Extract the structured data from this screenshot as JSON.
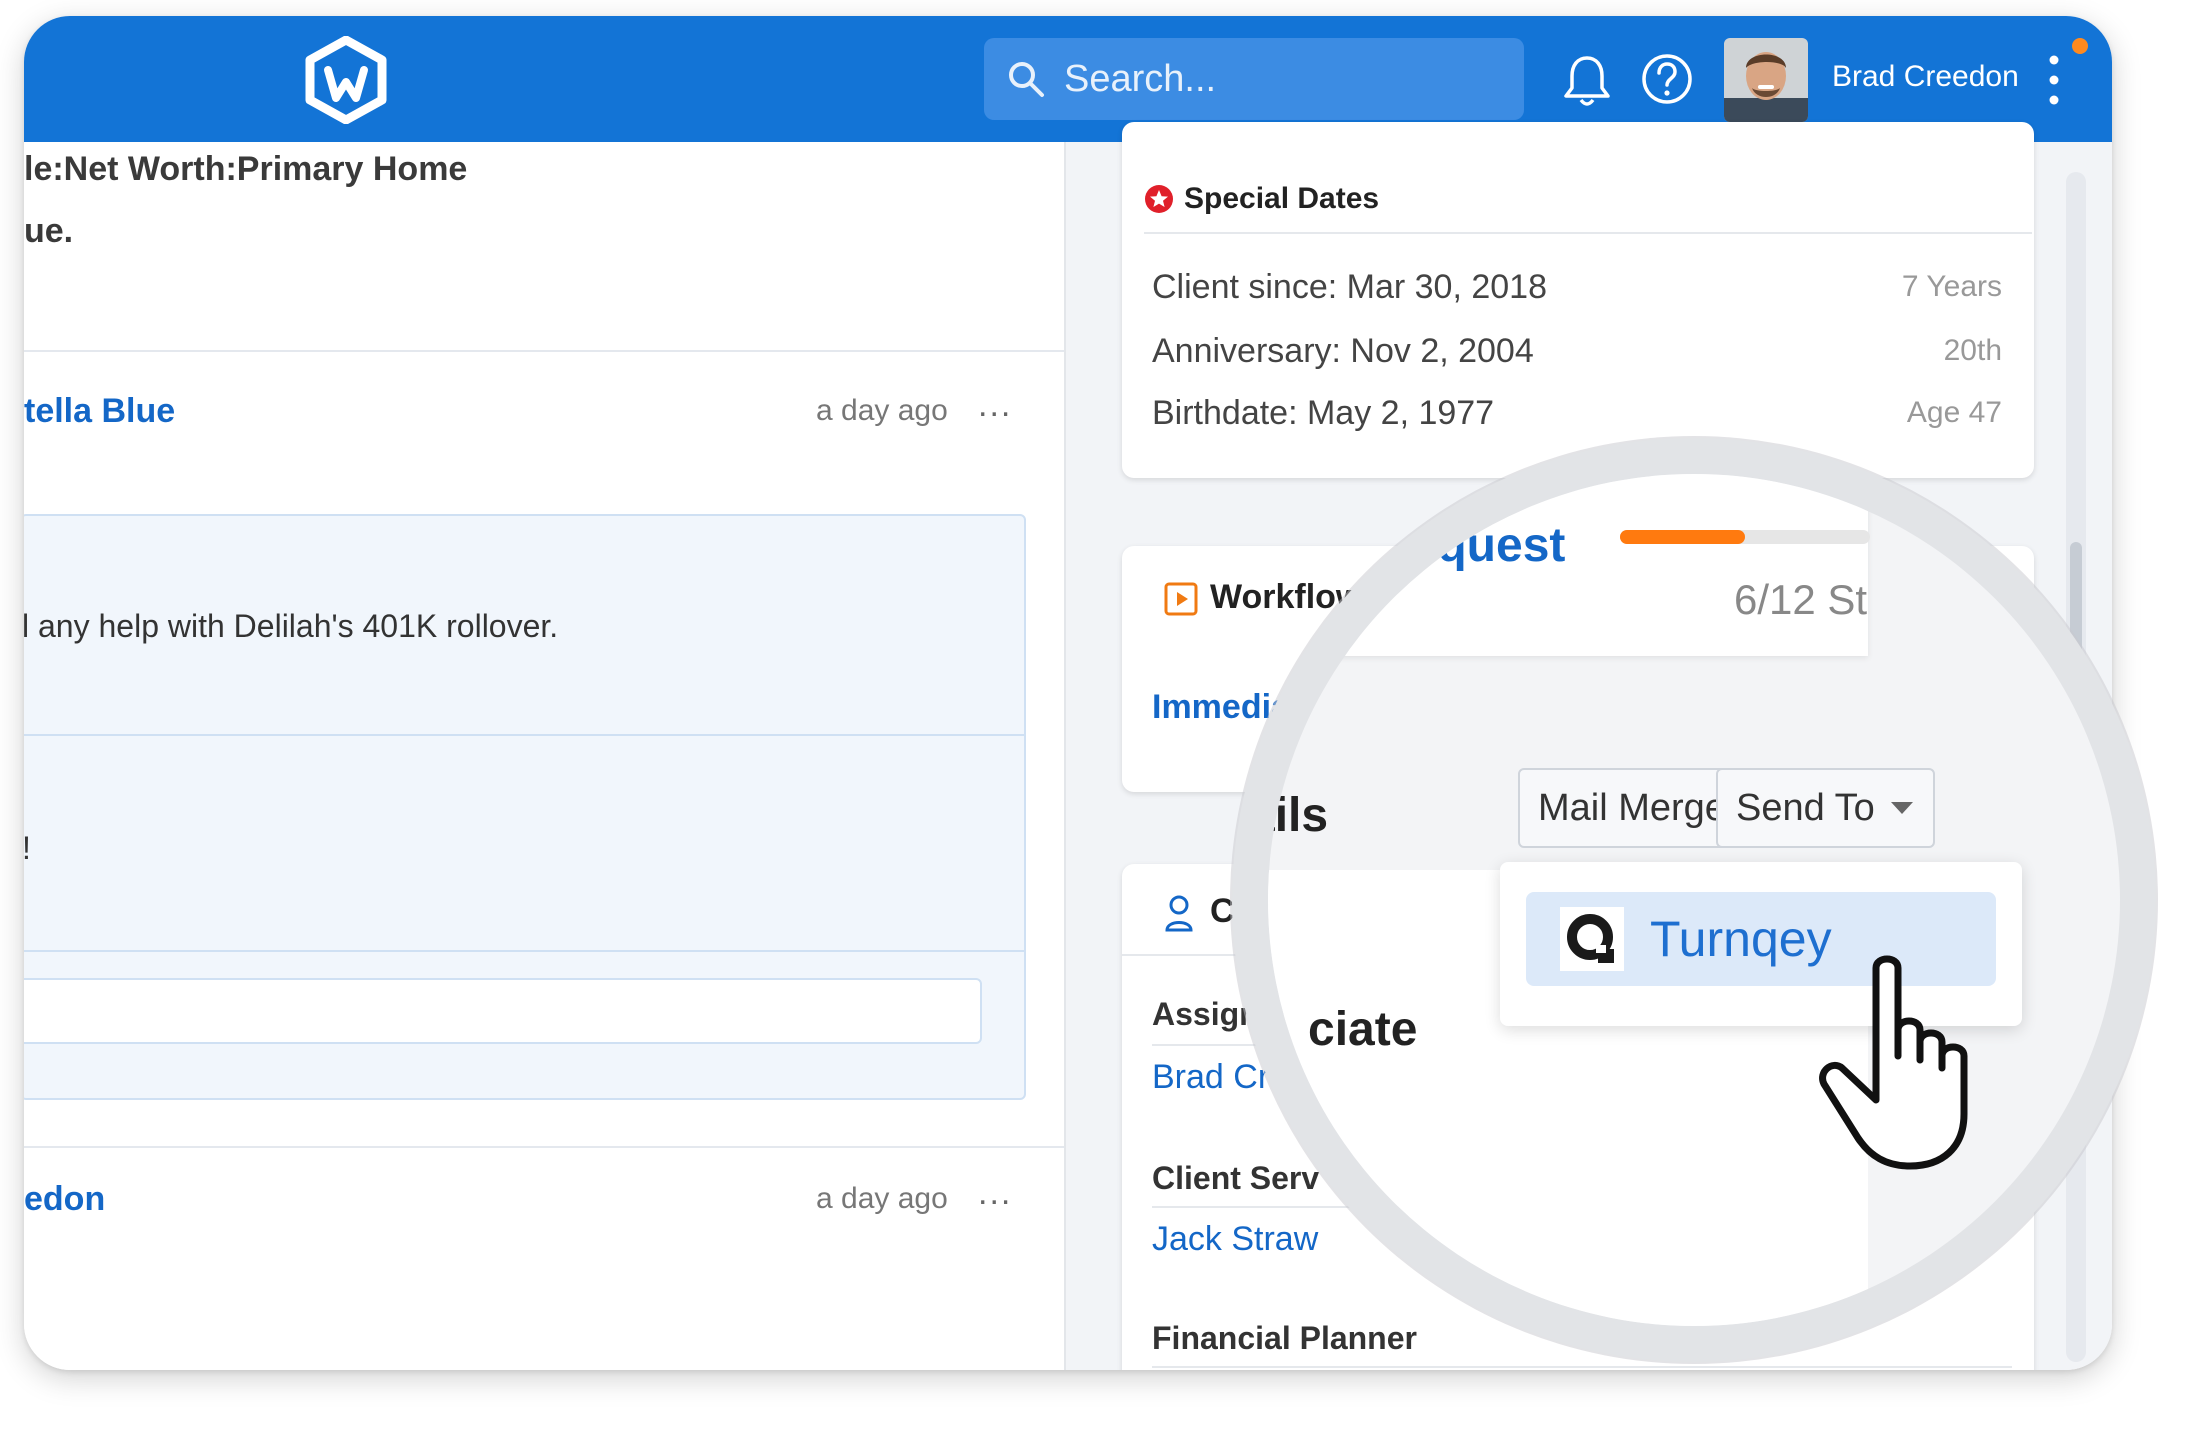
{
  "header": {
    "search_placeholder": "Search...",
    "user_name": "Brad Creedon",
    "icons": [
      "logo-icon",
      "search-icon",
      "bell-icon",
      "help-icon",
      "avatar",
      "kebab-menu-icon"
    ],
    "brand_color": "#1374d6",
    "notification_color": "#ff8a1f"
  },
  "feed": {
    "path_line1": "le:Net Worth:Primary Home",
    "path_line2": "ue.",
    "posts": [
      {
        "author": "tella Blue",
        "time": "a day ago",
        "more": "...",
        "messages": [
          "l any help with Delilah's 401K rollover.",
          "!"
        ]
      },
      {
        "author": "edon",
        "time": "a day ago",
        "more": "..."
      }
    ]
  },
  "special_dates": {
    "title": "Special Dates",
    "rows": [
      {
        "label": "Client since: Mar 30, 2018",
        "meta": "7 Years"
      },
      {
        "label": "Anniversary: Nov 2, 2004",
        "meta": "20th"
      },
      {
        "label": "Birthdate: May 2, 1977",
        "meta": "Age 47"
      }
    ]
  },
  "workflows": {
    "title": "Workflows",
    "link": "Immediat"
  },
  "contacts": {
    "title_fragment": "Co",
    "assign_label": "Assign",
    "assign_value": "Brad Cre",
    "client_service_label": "Client Serv",
    "client_service_value": "Jack Straw",
    "financial_planner_label": "Financial Planner"
  },
  "magnifier": {
    "request_title": "Request",
    "progress": 0.5,
    "steps_text": "6/12 St",
    "details_fragment": "ails",
    "mail_merge_label": "Mail Merge",
    "send_to_label": "Send To",
    "menu_items": [
      {
        "label": "Turnqey",
        "icon": "turnqey-logo-icon"
      }
    ],
    "associate_fragment": "ciate",
    "accent_color": "#ff7a0f"
  }
}
